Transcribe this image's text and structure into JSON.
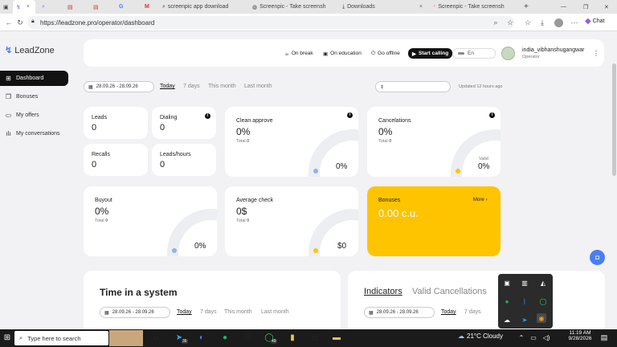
{
  "browser": {
    "tabs": [
      {
        "label": "",
        "icon": "leadzone-icon"
      },
      {
        "label": "",
        "icon": "search-icon"
      },
      {
        "label": "",
        "icon": "pdf-icon"
      },
      {
        "label": "",
        "icon": "pdf-icon"
      },
      {
        "label": "",
        "icon": "google-icon"
      },
      {
        "label": "",
        "icon": "gmail-icon"
      },
      {
        "label": "screenpic app download",
        "icon": "search-icon"
      },
      {
        "label": "Screenpic - Take screensh",
        "icon": "globe-icon"
      },
      {
        "label": "Downloads",
        "icon": "download-icon"
      },
      {
        "label": "Screenpic - Take screensh",
        "icon": "screenpic-icon"
      }
    ],
    "url": "https://leadzone.pro/operator/dashboard",
    "chat_label": "Chat"
  },
  "sidebar": {
    "logo": "LeadZone",
    "items": [
      {
        "label": "Dashboard",
        "icon": "grid-icon",
        "active": true
      },
      {
        "label": "Bonuses",
        "icon": "gift-icon",
        "active": false
      },
      {
        "label": "My offers",
        "icon": "folder-icon",
        "active": false
      },
      {
        "label": "My conversations",
        "icon": "waveform-icon",
        "active": false
      }
    ]
  },
  "header": {
    "on_break": "On break",
    "on_education": "On education",
    "go_offline": "Go offline",
    "start_calling": "Start calling",
    "language": "En",
    "user_name": "india_vibhanshugangwar",
    "user_role": "Operator"
  },
  "filters": {
    "date_range": "28.09.26 - 28.09.26",
    "periods": [
      "Today",
      "7 days",
      "This month",
      "Last month"
    ],
    "selected_period": "Today",
    "select_value": "",
    "updated": "Updated 12 hours ago"
  },
  "stats": {
    "leads": {
      "label": "Leads",
      "value": "0"
    },
    "dialing": {
      "label": "Dialing",
      "value": "0"
    },
    "recalls": {
      "label": "Recalls",
      "value": "0"
    },
    "leads_hours": {
      "label": "Leads/hours",
      "value": "0"
    },
    "clean_approve": {
      "label": "Clean approve",
      "value": "0%",
      "total_label": "Total",
      "total": "0",
      "gauge": "0%"
    },
    "cancelations": {
      "label": "Cancelations",
      "value": "0%",
      "total_label": "Total",
      "total": "0",
      "valid_label": "Valid",
      "gauge": "0%"
    },
    "buyout": {
      "label": "Buyout",
      "value": "0%",
      "total_label": "Total",
      "total": "0",
      "gauge": "0%"
    },
    "average_check": {
      "label": "Average check",
      "value": "0$",
      "total_label": "Total",
      "total": "0",
      "gauge": "$0"
    },
    "bonuses": {
      "label": "Bonuses",
      "value": "0.00 c.u.",
      "more": "More"
    }
  },
  "bottom": {
    "time_title": "Time in a system",
    "indicators_tab": "Indicators",
    "valid_cancellations_tab": "Valid Cancellations",
    "date_range": "28.09.26 - 28.09.26",
    "periods": [
      "Today",
      "7 days",
      "This month",
      "Last month"
    ],
    "ind_periods": [
      "Today",
      "7 days"
    ]
  },
  "taskbar": {
    "search_placeholder": "Type here to search",
    "badge_telegram": "36",
    "badge_whatsapp": "49",
    "weather": "21°C  Cloudy",
    "time": "11:19 AM",
    "date": "9/28/2026"
  },
  "colors": {
    "accent": "#ffc400",
    "dark": "#111111",
    "blue": "#4a7ef5"
  }
}
